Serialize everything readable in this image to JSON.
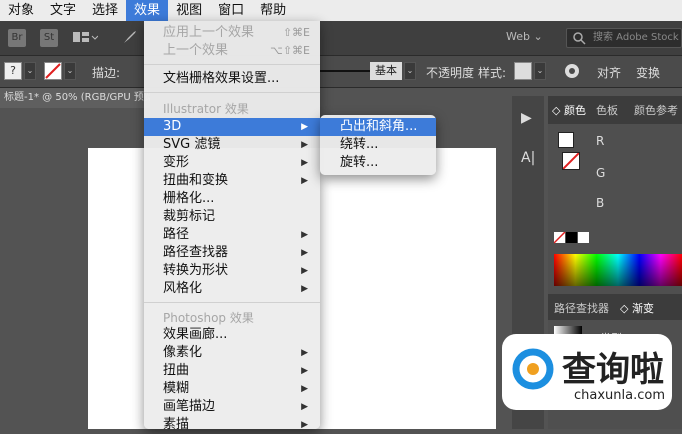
{
  "menubar": [
    "对象",
    "文字",
    "选择",
    "效果",
    "视图",
    "窗口",
    "帮助"
  ],
  "appbar": {
    "br_logo": "Br",
    "st_logo": "St",
    "workspace": "Web",
    "search_placeholder": "搜索 Adobe Stock"
  },
  "controlbar": {
    "stroke_label": "描边:",
    "style_basic": "基本",
    "opacity_label": "不透明度",
    "style_label": "样式:",
    "align_label": "对齐",
    "transform_label": "变换"
  },
  "doc_tab": "标题-1* @ 50% (RGB/GPU 预览)",
  "panels": {
    "tab_color": "颜色",
    "tab_swatches": "色板",
    "tab_color_guide": "颜色参考",
    "r": "R",
    "g": "G",
    "b": "B",
    "tab_pathfinder": "路径查找器",
    "tab_gradient": "渐变",
    "type_label": "类型:"
  },
  "effect_menu": {
    "apply_last": "应用上一个效果",
    "apply_last_sc": "⇧⌘E",
    "last": "上一个效果",
    "last_sc": "⌥⇧⌘E",
    "doc_raster": "文档栅格效果设置...",
    "illustrator_header": "Illustrator 效果",
    "items": [
      "3D",
      "SVG 滤镜",
      "变形",
      "扭曲和变换",
      "栅格化...",
      "裁剪标记",
      "路径",
      "路径查找器",
      "转换为形状",
      "风格化"
    ],
    "photoshop_header": "Photoshop 效果",
    "ps_items": [
      "效果画廊...",
      "像素化",
      "扭曲",
      "模糊",
      "画笔描边",
      "素描"
    ]
  },
  "submenu_3d": [
    "凸出和斜角...",
    "绕转...",
    "旋转..."
  ],
  "watermark": {
    "brand": "查询啦",
    "domain": "chaxunla.com"
  }
}
